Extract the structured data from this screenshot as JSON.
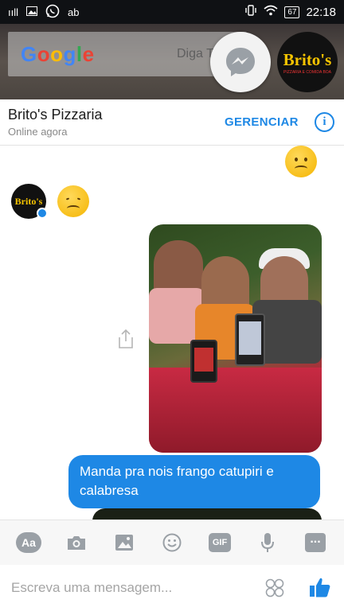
{
  "status_bar": {
    "signal": "ııll",
    "carrier_icon": "ab",
    "battery": "67",
    "time": "22:18"
  },
  "home": {
    "google_logo": "Google",
    "search_hint": "Diga T"
  },
  "chat_heads": {
    "brito_label": "Brito's",
    "brito_sub": "PIZZARIA E COMIDA BOA"
  },
  "header": {
    "title": "Brito's Pizzaria",
    "subtitle": "Online agora",
    "manage_label": "GERENCIAR",
    "info_icon": "i"
  },
  "messages": {
    "avatar_label": "Brito's",
    "outgoing_text": "Manda pra nois frango catupiri e calabresa"
  },
  "toolbar": {
    "aa_label": "Aa",
    "gif_label": "GIF",
    "more_label": "..."
  },
  "composer": {
    "placeholder": "Escreva uma mensagem..."
  },
  "colors": {
    "accent": "#1e88e5",
    "icon_gray": "#9aa0a6"
  }
}
